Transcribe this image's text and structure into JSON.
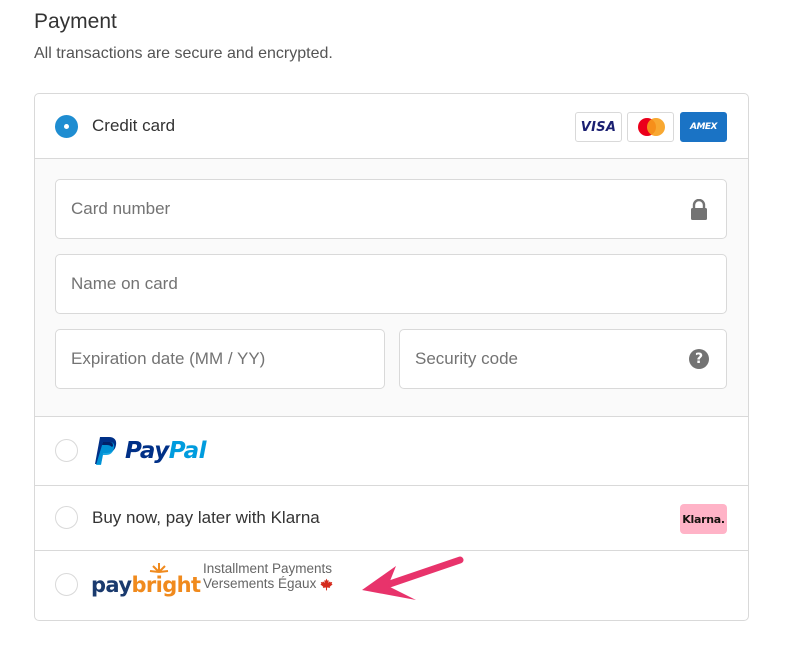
{
  "header": {
    "title": "Payment",
    "subtitle": "All transactions are secure and encrypted."
  },
  "credit_card": {
    "label": "Credit card",
    "selected": true,
    "brands": {
      "visa": "VISA",
      "amex": "AMEX"
    },
    "fields": {
      "card_number_placeholder": "Card number",
      "name_placeholder": "Name on card",
      "expiration_placeholder": "Expiration date (MM / YY)",
      "security_code_placeholder": "Security code"
    }
  },
  "paypal": {
    "word_pay": "Pay",
    "word_pal": "Pal",
    "selected": false
  },
  "klarna": {
    "label": "Buy now, pay later with Klarna",
    "badge": "Klarna.",
    "selected": false
  },
  "paybright": {
    "word_pay": "pay",
    "word_bright": "bright",
    "tagline_line1": "Installment Payments",
    "tagline_line2": "Versements Égaux",
    "selected": false
  },
  "colors": {
    "accent": "#1f8dd1",
    "border": "#d9d9d9",
    "annotation_arrow": "#e8336b"
  },
  "icons": {
    "lock": "lock-icon",
    "help": "question-circle-icon",
    "maple": "maple-leaf-icon"
  }
}
